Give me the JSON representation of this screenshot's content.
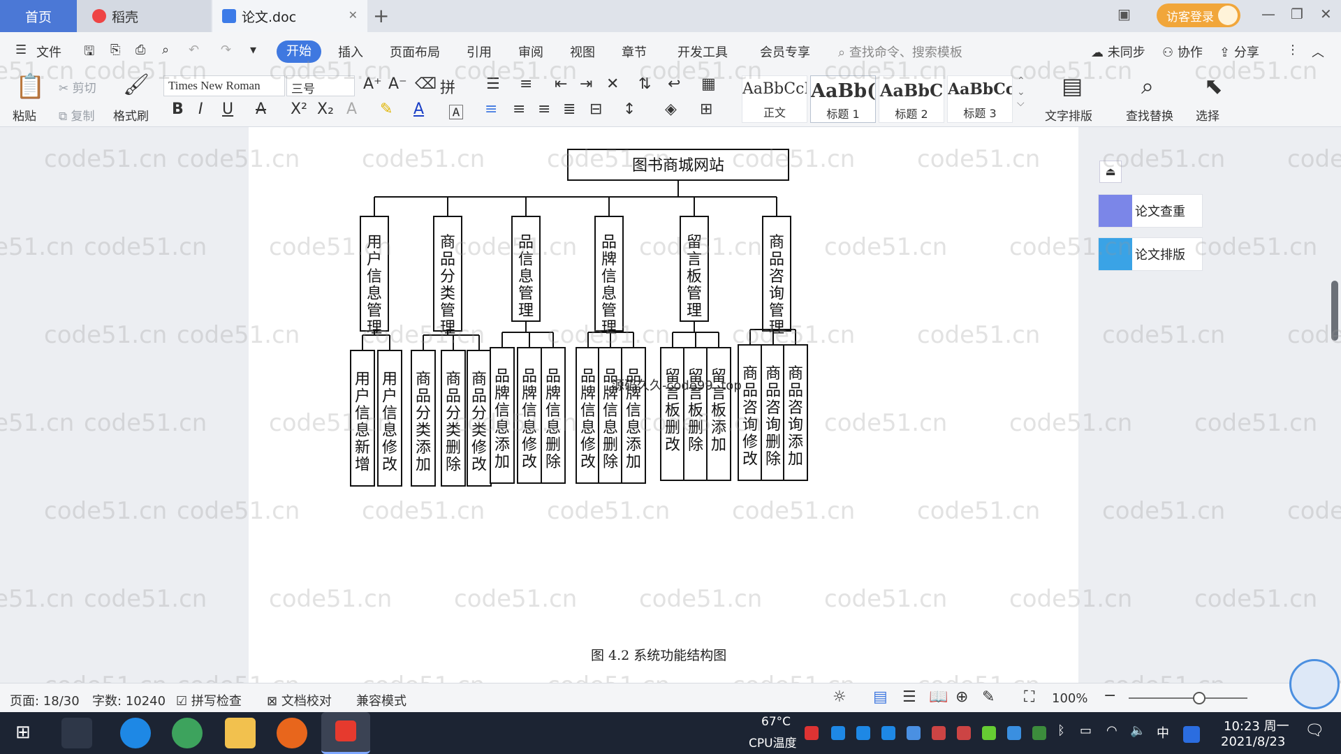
{
  "tabs": {
    "home": "首页",
    "daoke": "稻壳",
    "doc": "论文.doc"
  },
  "window": {
    "login": "访客登录"
  },
  "menu": {
    "file": "文件",
    "items": [
      "开始",
      "插入",
      "页面布局",
      "引用",
      "审阅",
      "视图",
      "章节",
      "开发工具",
      "会员专享"
    ],
    "search": "查找命令、搜索模板",
    "sync": "未同步",
    "collab": "协作",
    "share": "分享"
  },
  "ribbon": {
    "paste": "粘贴",
    "cut": "剪切",
    "copy": "复制",
    "format_painter": "格式刷",
    "font_name": "Times New Roman",
    "font_size": "三号",
    "styles": [
      {
        "sample": "AaBbCcI",
        "name": "正文"
      },
      {
        "sample": "AaBb(",
        "name": "标题 1"
      },
      {
        "sample": "AaBbC",
        "name": "标题 2"
      },
      {
        "sample": "AaBbCcI",
        "name": "标题 3"
      }
    ],
    "text_layout": "文字排版",
    "find_replace": "查找替换",
    "select": "选择"
  },
  "side": {
    "check": "论文查重",
    "layout": "论文排版"
  },
  "diagram": {
    "root": "图书商城网站",
    "groups": [
      {
        "label": "用户信息管理",
        "children": [
          "用户信息新增",
          "用户信息修改"
        ]
      },
      {
        "label": "商品分类管理",
        "children": [
          "商品分类添加",
          "商品分类删除",
          "商品分类修改"
        ]
      },
      {
        "label": "品信息管理",
        "children": [
          "品牌信息添加",
          "品牌信息修改",
          "品牌信息删除"
        ]
      },
      {
        "label": "品牌信息管理",
        "children": [
          "品牌信息修改",
          "品牌信息删除",
          "品牌信息添加"
        ]
      },
      {
        "label": "留言板管理",
        "children": [
          "留言板删改",
          "留言板删除",
          "留言板添加"
        ]
      },
      {
        "label": "商品咨询管理",
        "children": [
          "商品咨询修改",
          "商品咨询删除",
          "商品咨询添加"
        ]
      }
    ],
    "caption": "图 4.2  系统功能结构图",
    "overlay_text": "源码久久-code99. top"
  },
  "watermark": "code51.cn",
  "status": {
    "page": "页面: 18/30",
    "words": "字数: 10240",
    "spell": "拼写检查",
    "proof": "文档校对",
    "compat": "兼容模式",
    "zoom": "100%"
  },
  "taskbar": {
    "temp": "67°C",
    "cpu": "CPU温度",
    "ime": "中",
    "time": "10:23 周一",
    "date": "2021/8/23"
  },
  "colors": {
    "accent": "#3f78e0",
    "login": "#f1a63a",
    "taskbar": "#1c2433"
  }
}
